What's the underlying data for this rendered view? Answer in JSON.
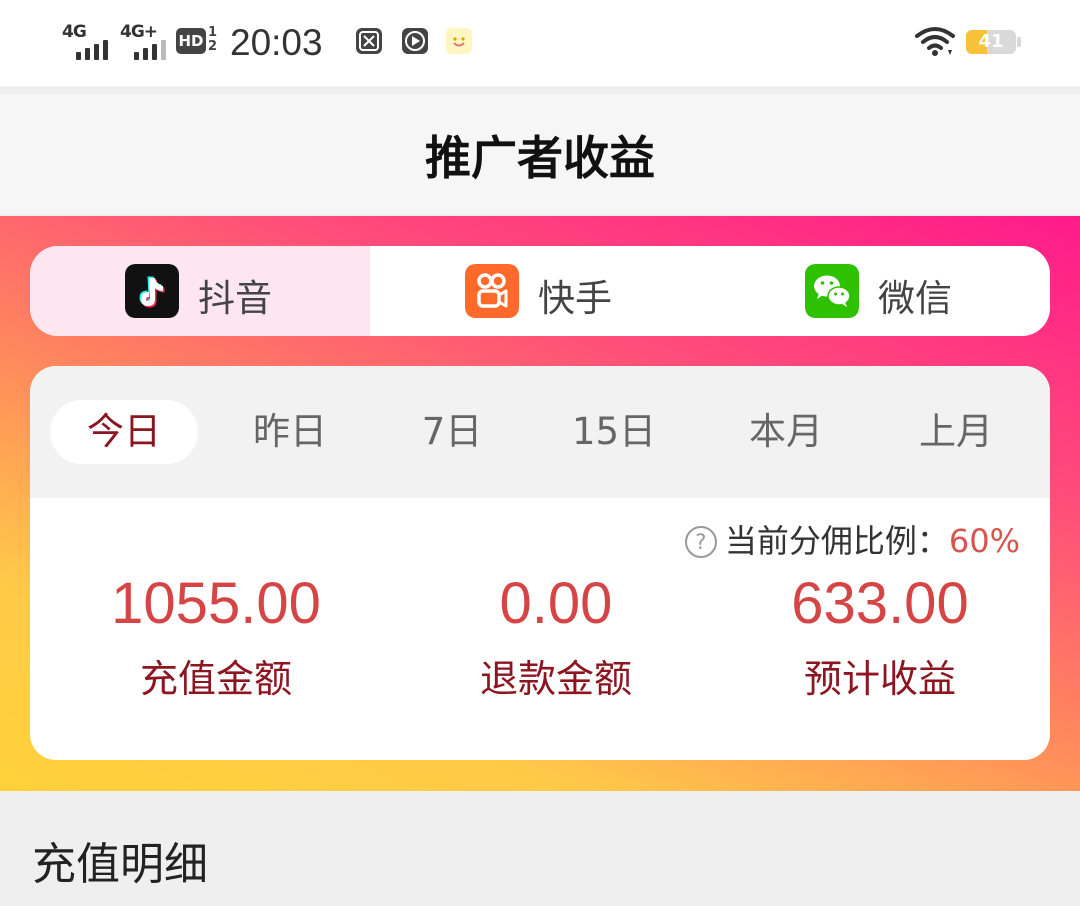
{
  "status_bar": {
    "sim1_label": "4G",
    "sim2_label": "4G+",
    "hd_label": "HD",
    "hd_sub_top": "1",
    "hd_sub_bottom": "2",
    "time": "20:03",
    "battery_percent": "41",
    "icons": [
      "screenshot-icon",
      "play-icon",
      "smiley-app-icon",
      "wifi-icon",
      "battery-icon"
    ]
  },
  "header": {
    "title": "推广者收益"
  },
  "platforms": {
    "items": [
      {
        "label": "抖音",
        "icon": "douyin-icon",
        "active": true
      },
      {
        "label": "快手",
        "icon": "kuaishou-icon",
        "active": false
      },
      {
        "label": "微信",
        "icon": "wechat-icon",
        "active": false
      }
    ]
  },
  "periods": {
    "items": [
      "今日",
      "昨日",
      "7日",
      "15日",
      "本月",
      "上月"
    ],
    "selected": "今日"
  },
  "commission": {
    "label": "当前分佣比例：",
    "value": "60%",
    "help_icon": "?"
  },
  "stats": [
    {
      "value": "1055.00",
      "label": "充值金额"
    },
    {
      "value": "0.00",
      "label": "退款金额"
    },
    {
      "value": "633.00",
      "label": "预计收益"
    }
  ],
  "section": {
    "title": "充值明细"
  },
  "colors": {
    "accent_red": "#d64545",
    "label_dark_red": "#8c1520",
    "gradient_start": "#ffd23a",
    "gradient_end": "#ff1a8a"
  }
}
